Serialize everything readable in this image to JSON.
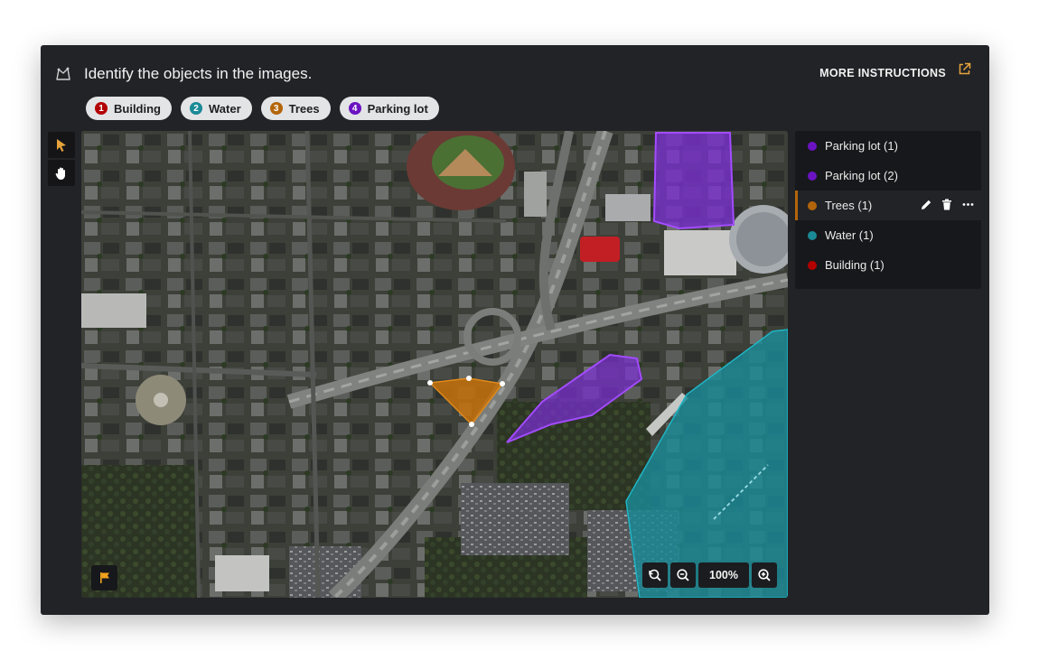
{
  "header": {
    "title": "Identify the objects in the images.",
    "more_instructions": "MORE INSTRUCTIONS",
    "task_icon": "annotation-task-icon",
    "external_icon": "external-link-icon"
  },
  "labels": [
    {
      "num": "1",
      "name": "Building",
      "color": "#b30000"
    },
    {
      "num": "2",
      "name": "Water",
      "color": "#1a8a96"
    },
    {
      "num": "3",
      "name": "Trees",
      "color": "#b3650b"
    },
    {
      "num": "4",
      "name": "Parking lot",
      "color": "#6b13c2"
    }
  ],
  "tools": [
    {
      "icon": "select-cursor-icon",
      "active": true
    },
    {
      "icon": "pan-hand-icon",
      "active": false
    }
  ],
  "viewer": {
    "zoom": "100%",
    "reset_icon": "reset-view-icon",
    "zoom_out_icon": "zoom-out-icon",
    "zoom_in_icon": "zoom-in-icon",
    "flag_icon": "flag-icon"
  },
  "layers": [
    {
      "name": "Parking lot (1)",
      "color": "#6b13c2",
      "selected": false
    },
    {
      "name": "Parking lot (2)",
      "color": "#6b13c2",
      "selected": false
    },
    {
      "name": "Trees (1)",
      "color": "#b3650b",
      "selected": true
    },
    {
      "name": "Water (1)",
      "color": "#1a8a96",
      "selected": false
    },
    {
      "name": "Building (1)",
      "color": "#b30000",
      "selected": false
    }
  ],
  "layer_actions": [
    "edit-icon",
    "delete-icon",
    "more-icon"
  ],
  "colors": {
    "panel": "#222327",
    "accent_selected": "#b3650b",
    "chip_bg": "#e3e4e6"
  }
}
